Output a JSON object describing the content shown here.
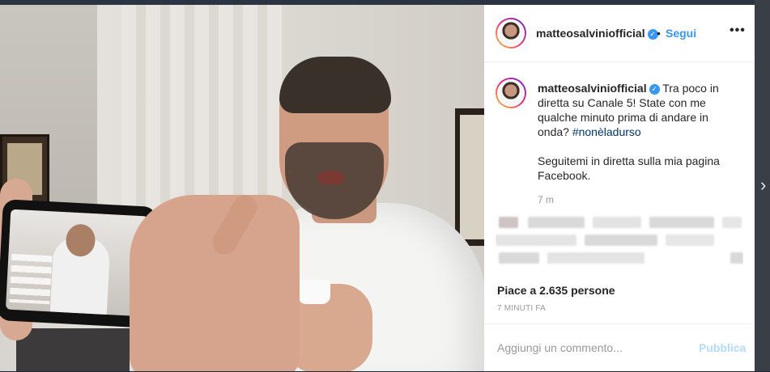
{
  "post": {
    "username": "matteosalviniofficial",
    "header_dot": "•",
    "follow_label": "Segui",
    "more_label": "•••",
    "caption": {
      "username": "matteosalviniofficial",
      "text_before_tag": "Tra poco in diretta su Canale 5! State con me qualche minuto prima di andare in onda?",
      "hashtag": "#nonèladurso",
      "paragraph2": "Seguitemi in diretta sulla mia pagina Facebook."
    },
    "time_ago": "7 m",
    "likes": "Piace a 2.635 persone",
    "posted_at": "7 MINUTI FA",
    "comment_placeholder": "Aggiungi un commento...",
    "publish_label": "Pubblica",
    "next_label": "›"
  },
  "colors": {
    "accent": "#3897f0",
    "hashtag": "#003569",
    "publish_disabled": "#b3dbff"
  },
  "icons": [
    "verified-badge-icon",
    "more-options-icon",
    "next-post-chevron-icon"
  ]
}
